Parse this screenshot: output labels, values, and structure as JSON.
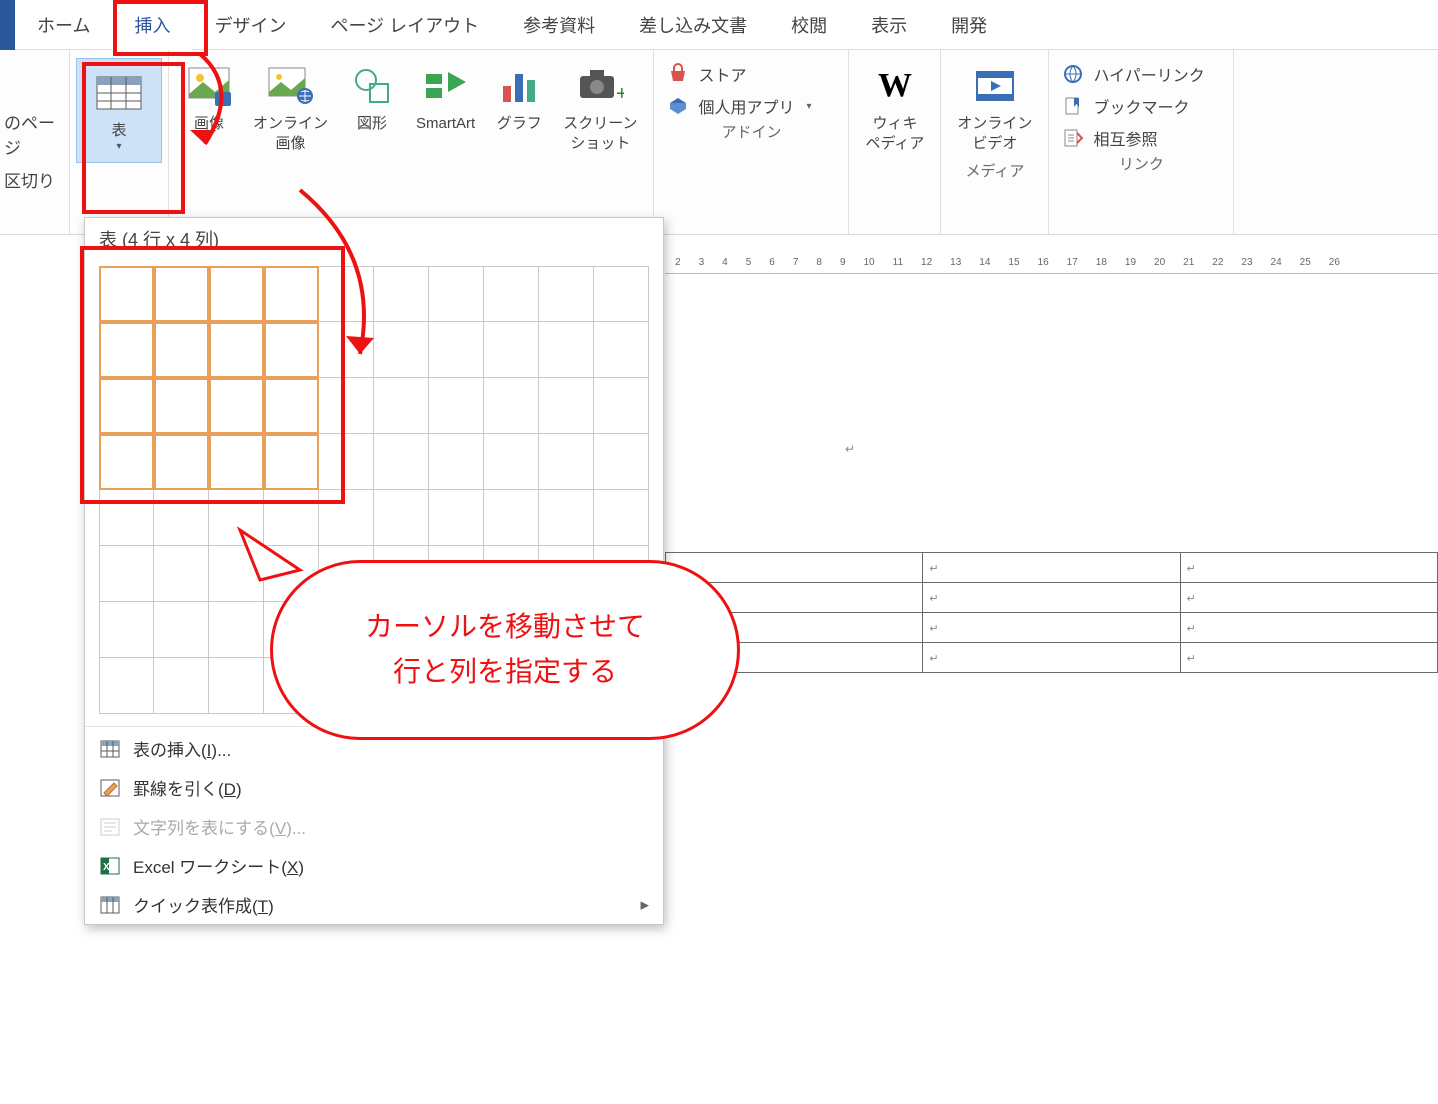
{
  "tabs": {
    "home": "ホーム",
    "insert": "挿入",
    "design": "デザイン",
    "layout": "ページ レイアウト",
    "references": "参考資料",
    "mailings": "差し込み文書",
    "review": "校閲",
    "view": "表示",
    "developer": "開発"
  },
  "leftcut": {
    "page": "のページ",
    "break": "区切り"
  },
  "ribbon": {
    "table": "表",
    "picture": "画像",
    "onlinepic": "オンライン\n画像",
    "shapes": "図形",
    "smartart": "SmartArt",
    "chart": "グラフ",
    "screenshot": "スクリーン\nショット",
    "store": "ストア",
    "myapps": "個人用アプリ",
    "wikipedia": "ウィキ\nペディア",
    "onlinevideo": "オンライン\nビデオ",
    "hyperlink": "ハイパーリンク",
    "bookmark": "ブックマーク",
    "crossref": "相互参照",
    "group_addins": "アドイン",
    "group_media": "メディア",
    "group_links": "リンク"
  },
  "dropdown": {
    "header": "表 (4 行 x 4 列)",
    "selRows": 4,
    "selCols": 4,
    "totalRows": 8,
    "totalCols": 10,
    "menu": {
      "insert": "表の挿入(I)...",
      "draw": "罫線を引く(D)",
      "convert": "文字列を表にする(V)...",
      "excel": "Excel ワークシート(X)",
      "quick": "クイック表作成(T)"
    }
  },
  "callout": {
    "line1": "カーソルを移動させて",
    "line2": "行と列を指定する"
  },
  "ruler_vals": [
    "2",
    "3",
    "4",
    "5",
    "6",
    "7",
    "8",
    "9",
    "10",
    "11",
    "12",
    "13",
    "14",
    "15",
    "16",
    "17",
    "18",
    "19",
    "20",
    "21",
    "22",
    "23",
    "24",
    "25",
    "26"
  ],
  "preview_table": {
    "rows": 4,
    "cols": 3
  }
}
